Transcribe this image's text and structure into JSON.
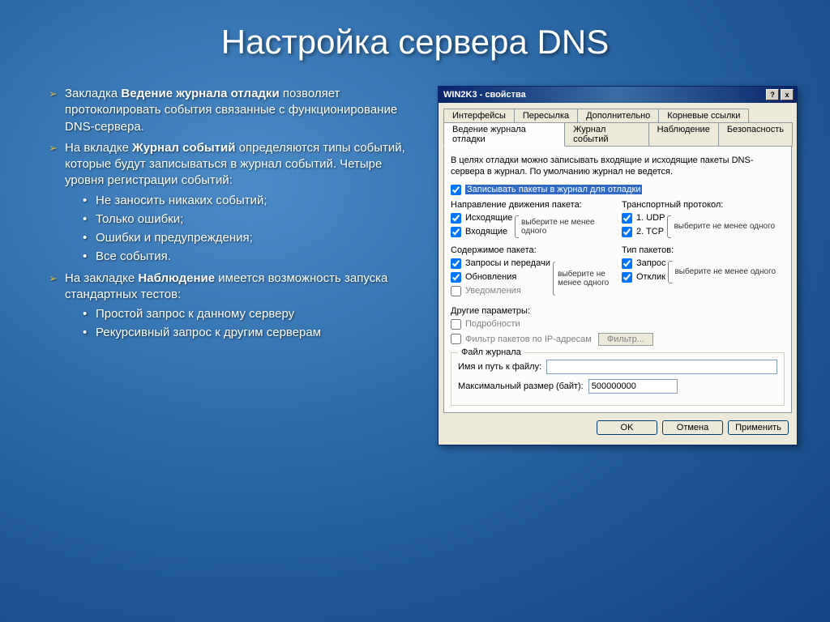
{
  "slide": {
    "title": "Настройка сервера DNS",
    "bullets": [
      {
        "text_pre": "Закладка ",
        "bold": "Ведение журнала отладки",
        "text_post": " позволяет протоколировать события связанные с функционирование DNS-сервера."
      },
      {
        "text_pre": "На вкладке ",
        "bold": "Журнал событий",
        "text_post": " определяются типы событий, которые будут записываться в журнал событий. Четыре уровня регистрации событий:",
        "sub": [
          "Не заносить никаких событий;",
          "Только ошибки;",
          "Ошибки и предупреждения;",
          "Все события."
        ]
      },
      {
        "text_pre": "На закладке ",
        "bold": "Наблюдение",
        "text_post": " имеется возможность запуска стандартных тестов:",
        "sub": [
          "Простой запрос  к данному серверу",
          "Рекурсивный запрос к другим серверам"
        ]
      }
    ]
  },
  "dialog": {
    "title": "WIN2K3 - свойства",
    "help_btn": "?",
    "close_btn": "x",
    "tabs_row1": [
      "Интерфейсы",
      "Пересылка",
      "Дополнительно",
      "Корневые ссылки"
    ],
    "tabs_row2": [
      "Ведение журнала отладки",
      "Журнал событий",
      "Наблюдение",
      "Безопасность"
    ],
    "active_tab": "Ведение журнала отладки",
    "description": "В целях отладки можно записывать входящие и исходящие пакеты DNS-сервера в журнал. По умолчанию журнал не ведется.",
    "main_checkbox": "Записывать пакеты в журнал для отладки",
    "direction": {
      "title": "Направление движения пакета:",
      "opts": [
        "Исходящие",
        "Входящие"
      ],
      "hint": "выберите не менее одного"
    },
    "transport": {
      "title": "Транспортный протокол:",
      "opts": [
        "1. UDP",
        "2. TCP"
      ],
      "hint": "выберите не менее одного"
    },
    "content": {
      "title": "Содержимое пакета:",
      "opts": [
        "Запросы и передачи",
        "Обновления",
        "Уведомления"
      ],
      "checked": [
        true,
        true,
        false
      ],
      "hint": "выберите не менее одного"
    },
    "packet_type": {
      "title": "Тип пакетов:",
      "opts": [
        "Запрос",
        "Отклик"
      ],
      "hint": "выберите не менее одного"
    },
    "other": {
      "title": "Другие параметры:",
      "details": "Подробности",
      "filter_ip": "Фильтр пакетов по IP-адресам",
      "filter_btn": "Фильтр..."
    },
    "file_group": {
      "title": "Файл журнала",
      "path_label": "Имя и путь к файлу:",
      "path_value": "",
      "size_label": "Максимальный размер (байт):",
      "size_value": "500000000"
    },
    "buttons": {
      "ok": "OK",
      "cancel": "Отмена",
      "apply": "Применить"
    }
  }
}
